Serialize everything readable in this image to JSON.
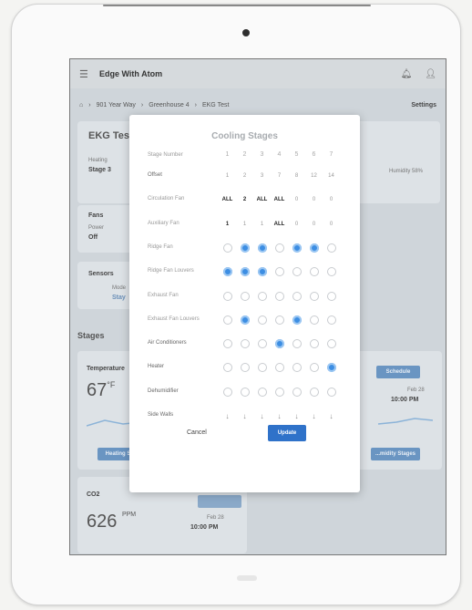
{
  "app": {
    "title": "Edge With Atom"
  },
  "breadcrumb": [
    "901 Year Way",
    "Greenhouse 4",
    "EKG Test"
  ],
  "breadcrumb_settings": "Settings",
  "background": {
    "zone_title": "EKG Test",
    "heating_label": "Heating",
    "stage_value": "Stage 3",
    "fans_title": "Fans",
    "power_label": "Power",
    "power_value": "Off",
    "sensors_title": "Sensors",
    "mode_label": "Mode",
    "mode_value": "Stay",
    "humidity_text": "Humidity 58%",
    "stages_title": "Stages",
    "temperature_title": "Temperature",
    "temperature_value": "67",
    "temperature_unit": "°F",
    "schedule_button": "Schedule",
    "temp_date": "Feb 28",
    "temp_time": "10:00 PM",
    "heating_stages_button": "Heating St...",
    "humidity_stages_button": "...midity Stages",
    "co2_title": "CO2",
    "co2_value": "626",
    "co2_unit": "PPM",
    "co2_date": "Feb 28",
    "co2_time": "10:00 PM"
  },
  "modal": {
    "title": "Cooling Stages",
    "header_label": "Stage Number",
    "stage_numbers": [
      "1",
      "2",
      "3",
      "4",
      "5",
      "6",
      "7"
    ],
    "rows": [
      {
        "label": "Offset",
        "type": "text",
        "cells": [
          "1",
          "2",
          "3",
          "7",
          "8",
          "12",
          "14"
        ],
        "strong": [
          false,
          false,
          false,
          false,
          false,
          false,
          false
        ]
      },
      {
        "label": "Circulation Fan",
        "type": "text",
        "cells": [
          "ALL",
          "2",
          "ALL",
          "ALL",
          "0",
          "0",
          "0"
        ],
        "strong": [
          true,
          true,
          true,
          true,
          false,
          false,
          false
        ]
      },
      {
        "label": "Auxiliary Fan",
        "type": "text",
        "cells": [
          "1",
          "1",
          "1",
          "ALL",
          "0",
          "0",
          "0"
        ],
        "strong": [
          true,
          false,
          false,
          true,
          false,
          false,
          false
        ]
      },
      {
        "label": "Ridge Fan",
        "type": "dots",
        "on": [
          false,
          true,
          true,
          false,
          true,
          true,
          false
        ]
      },
      {
        "label": "Ridge Fan Louvers",
        "type": "dots",
        "on": [
          true,
          true,
          true,
          false,
          false,
          false,
          false
        ]
      },
      {
        "label": "Exhaust Fan",
        "type": "dots",
        "on": [
          false,
          false,
          false,
          false,
          false,
          false,
          false
        ]
      },
      {
        "label": "Exhaust Fan Louvers",
        "type": "dots",
        "on": [
          false,
          true,
          false,
          false,
          true,
          false,
          false
        ]
      },
      {
        "label": "Air Conditioners",
        "type": "dots",
        "on": [
          false,
          false,
          false,
          true,
          false,
          false,
          false
        ]
      },
      {
        "label": "Heater",
        "type": "dots",
        "on": [
          false,
          false,
          false,
          false,
          false,
          false,
          true
        ]
      },
      {
        "label": "Dehumidifier",
        "type": "dots",
        "on": [
          false,
          false,
          false,
          false,
          false,
          false,
          false
        ]
      },
      {
        "label": "Side Walls",
        "type": "arrows",
        "cells": [
          "↓",
          "↓",
          "↓",
          "↓",
          "↓",
          "↓",
          "↓"
        ]
      }
    ],
    "cancel_label": "Cancel",
    "update_label": "Update"
  }
}
